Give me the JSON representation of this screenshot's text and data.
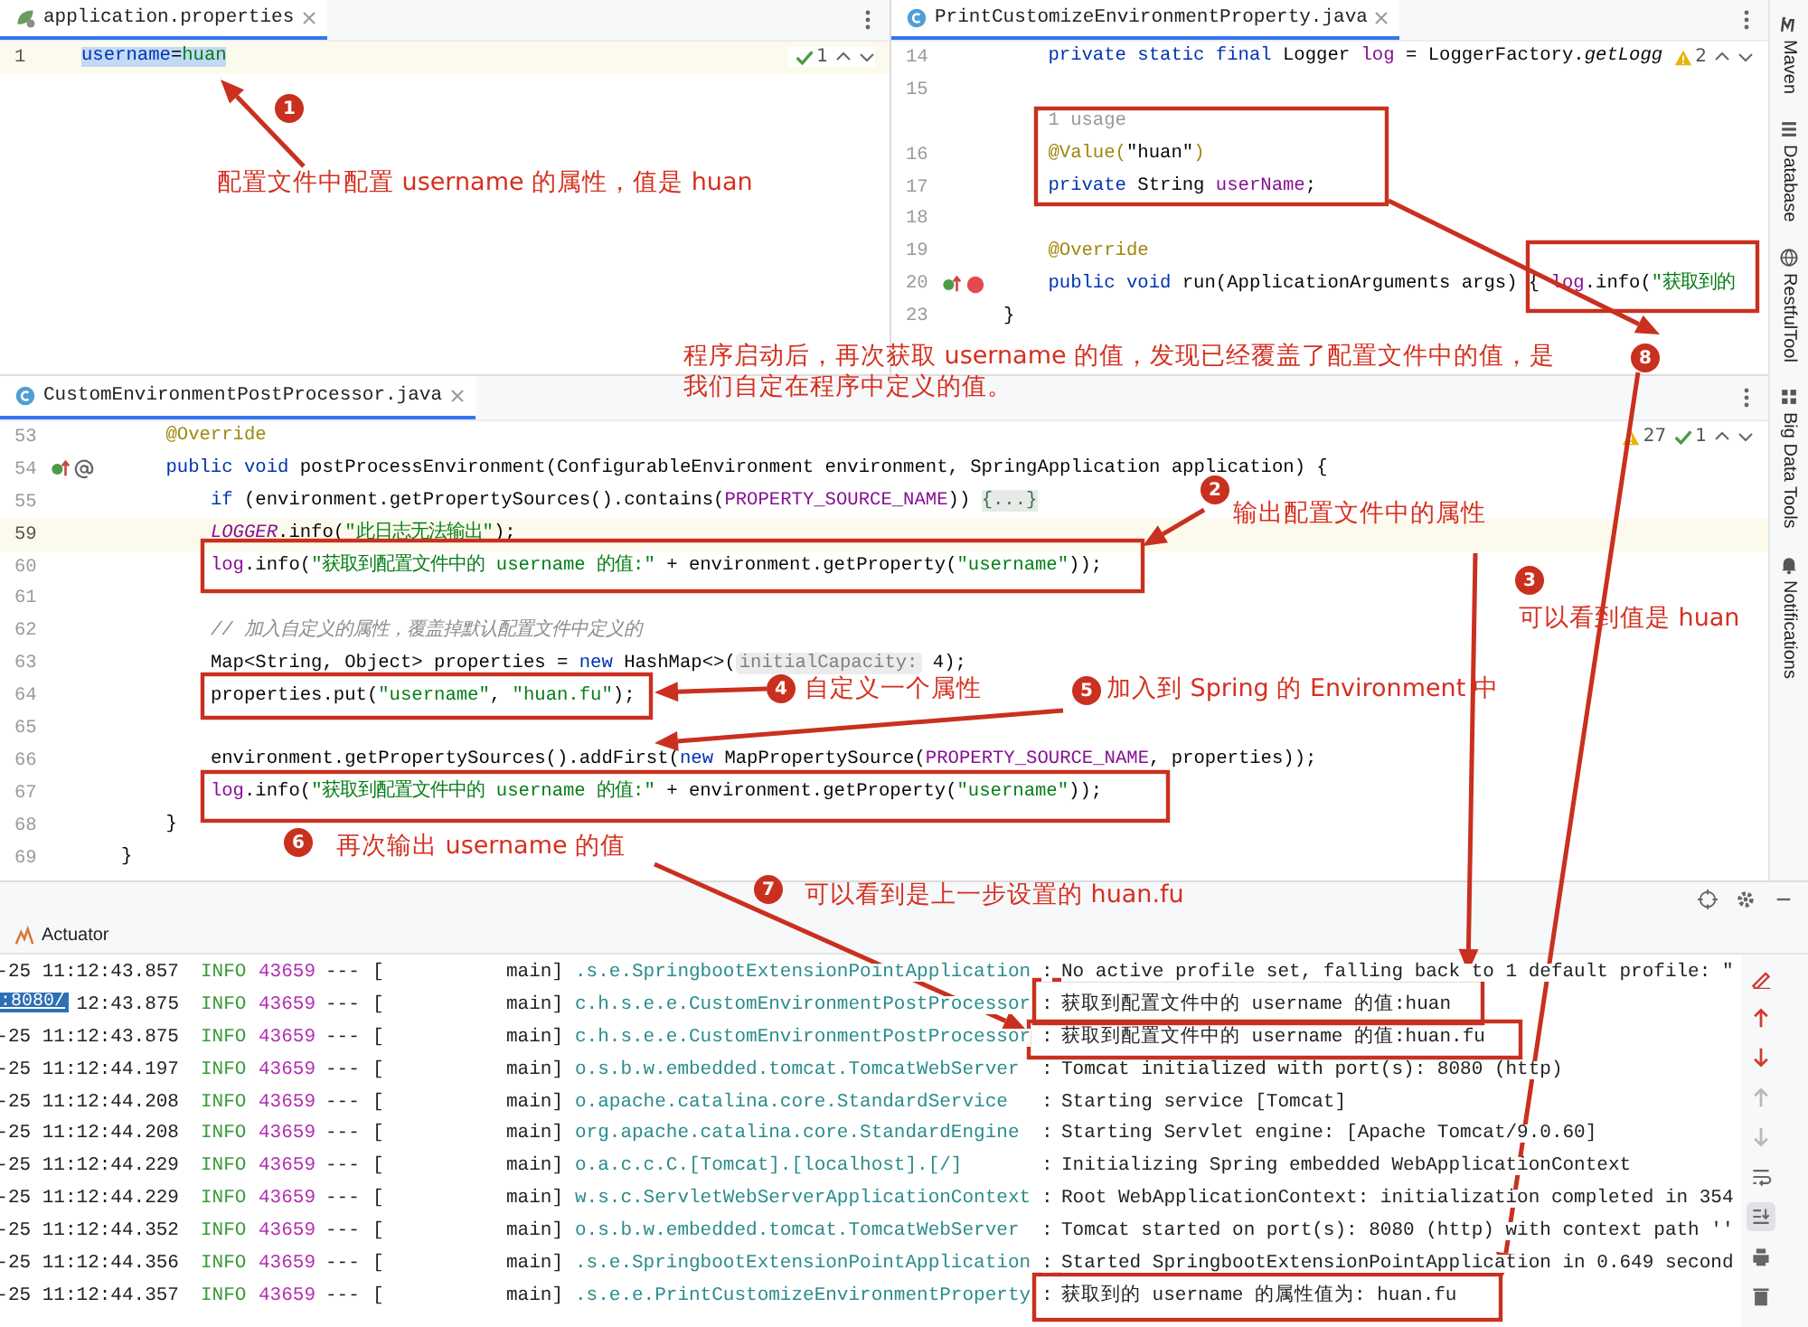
{
  "editors_top": [
    {
      "tab": {
        "name": "application.properties",
        "kind": "properties",
        "selected": true
      },
      "inspections": [
        {
          "kind": "check",
          "count": "1"
        }
      ],
      "lines": [
        {
          "number": "1",
          "current": true,
          "selected": true,
          "tokens": [
            {
              "text": "username",
              "kind": "key"
            },
            {
              "text": "=",
              "kind": "plain"
            },
            {
              "text": "huan",
              "kind": "value"
            }
          ]
        }
      ]
    },
    {
      "tab": {
        "name": "PrintCustomizeEnvironmentProperty.java",
        "kind": "class",
        "selected": true
      },
      "inspections": [
        {
          "kind": "warning",
          "count": "2"
        }
      ],
      "lines": [
        {
          "number": "14",
          "current": false,
          "tokens": [
            {
              "text": "    private static final ",
              "kind": "kw"
            },
            {
              "text": "Logger ",
              "kind": "plain"
            },
            {
              "text": "log",
              "kind": "field"
            },
            {
              "text": " = LoggerFactory.",
              "kind": "plain"
            },
            {
              "text": "getLogg",
              "kind": "italic"
            }
          ]
        },
        {
          "number": "15",
          "current": false
        },
        {
          "current": false,
          "tokens": [
            {
              "text": "    1 usage",
              "kind": "usage"
            }
          ]
        },
        {
          "number": "16",
          "current": false,
          "tokens": [
            {
              "text": "    @Value(",
              "kind": "ann"
            },
            {
              "text": "\"huan\"",
              "kind": "plain"
            },
            {
              "text": ")",
              "kind": "ann"
            }
          ]
        },
        {
          "number": "17",
          "current": false,
          "tokens": [
            {
              "text": "    private ",
              "kind": "kw"
            },
            {
              "text": "String ",
              "kind": "plain"
            },
            {
              "text": "userName",
              "kind": "field"
            },
            {
              "text": ";",
              "kind": "plain"
            }
          ]
        },
        {
          "number": "18",
          "current": false
        },
        {
          "number": "19",
          "current": false,
          "tokens": [
            {
              "text": "    @Override",
              "kind": "ann"
            }
          ]
        },
        {
          "number": "20",
          "current": false,
          "markers": [
            {
              "kind": "override"
            },
            {
              "kind": "breakpoint"
            }
          ],
          "tokens": [
            {
              "text": "    public void ",
              "kind": "kw"
            },
            {
              "text": "run(ApplicationArguments args) { ",
              "kind": "plain"
            },
            {
              "text": "log",
              "kind": "field"
            },
            {
              "text": ".info(",
              "kind": "plain"
            },
            {
              "text": "\"获取到的",
              "kind": "str"
            }
          ]
        },
        {
          "number": "23",
          "current": false,
          "tokens": [
            {
              "text": "}",
              "kind": "plain"
            }
          ]
        }
      ]
    }
  ],
  "main_editor": {
    "tab": {
      "name": "CustomEnvironmentPostProcessor.java",
      "kind": "class",
      "selected": true
    },
    "inspections": [
      {
        "kind": "warning",
        "count": "27"
      },
      {
        "kind": "check",
        "count": "1"
      }
    ],
    "lines": [
      {
        "number": "53",
        "current": false,
        "tokens": [
          {
            "text": "    @Override",
            "kind": "ann"
          }
        ]
      },
      {
        "number": "54",
        "current": false,
        "markers": [
          {
            "kind": "override"
          },
          {
            "kind": "at"
          }
        ],
        "tokens": [
          {
            "text": "    public void ",
            "kind": "kw"
          },
          {
            "text": "postProcessEnvironment(ConfigurableEnvironment environment, SpringApplication application) {",
            "kind": "plain"
          }
        ]
      },
      {
        "number": "55",
        "current": false,
        "tokens": [
          {
            "text": "        if ",
            "kind": "kw"
          },
          {
            "text": "(environment.getPropertySources().contains(",
            "kind": "plain"
          },
          {
            "text": "PROPERTY_SOURCE_NAME",
            "kind": "field"
          },
          {
            "text": ")) ",
            "kind": "plain"
          },
          {
            "text": "{...}",
            "kind": "fold"
          }
        ]
      },
      {
        "number": "59",
        "current": true,
        "tokens": [
          {
            "text": "        LOGGER",
            "kind": "static"
          },
          {
            "text": ".info(",
            "kind": "plain"
          },
          {
            "text": "\"此日志无法输出\"",
            "kind": "str"
          },
          {
            "text": ");",
            "kind": "plain"
          }
        ]
      },
      {
        "number": "60",
        "current": false,
        "tokens": [
          {
            "text": "        log",
            "kind": "field"
          },
          {
            "text": ".info(",
            "kind": "plain"
          },
          {
            "text": "\"获取到配置文件中的 username 的值:\"",
            "kind": "str"
          },
          {
            "text": " + environment.getProperty(",
            "kind": "plain"
          },
          {
            "text": "\"username\"",
            "kind": "str"
          },
          {
            "text": "));",
            "kind": "plain"
          }
        ]
      },
      {
        "number": "61",
        "current": false
      },
      {
        "number": "62",
        "current": false,
        "tokens": [
          {
            "text": "        // 加入自定义的属性，覆盖掉默认配置文件中定义的",
            "kind": "comment"
          }
        ]
      },
      {
        "number": "63",
        "current": false,
        "tokens": [
          {
            "text": "        Map<String, Object> properties = ",
            "kind": "plain"
          },
          {
            "text": "new ",
            "kind": "kw"
          },
          {
            "text": "HashMap<>(",
            "kind": "plain"
          },
          {
            "text": "initialCapacity:",
            "kind": "hint"
          },
          {
            "text": " 4);",
            "kind": "plain"
          }
        ]
      },
      {
        "number": "64",
        "current": false,
        "tokens": [
          {
            "text": "        properties.put(",
            "kind": "plain"
          },
          {
            "text": "\"username\"",
            "kind": "str"
          },
          {
            "text": ", ",
            "kind": "plain"
          },
          {
            "text": "\"huan.fu\"",
            "kind": "str"
          },
          {
            "text": ");",
            "kind": "plain"
          }
        ]
      },
      {
        "number": "65",
        "current": false
      },
      {
        "number": "66",
        "current": false,
        "tokens": [
          {
            "text": "        environment.getPropertySources().addFirst(",
            "kind": "plain"
          },
          {
            "text": "new ",
            "kind": "kw"
          },
          {
            "text": "MapPropertySource(",
            "kind": "plain"
          },
          {
            "text": "PROPERTY_SOURCE_NAME",
            "kind": "field"
          },
          {
            "text": ", properties));",
            "kind": "plain"
          }
        ]
      },
      {
        "number": "67",
        "current": false,
        "tokens": [
          {
            "text": "        log",
            "kind": "field"
          },
          {
            "text": ".info(",
            "kind": "plain"
          },
          {
            "text": "\"获取到配置文件中的 username 的值:\"",
            "kind": "str"
          },
          {
            "text": " + environment.getProperty(",
            "kind": "plain"
          },
          {
            "text": "\"username\"",
            "kind": "str"
          },
          {
            "text": "));",
            "kind": "plain"
          }
        ]
      },
      {
        "number": "68",
        "current": false,
        "tokens": [
          {
            "text": "    }",
            "kind": "plain"
          }
        ]
      },
      {
        "number": "69",
        "current": false,
        "tokens": [
          {
            "text": "}",
            "kind": "plain"
          }
        ]
      }
    ]
  },
  "tool_windows": [
    {
      "kind": "maven",
      "label": "Maven"
    },
    {
      "kind": "database",
      "label": "Database"
    },
    {
      "kind": "globe",
      "label": "RestfulTool"
    },
    {
      "kind": "bigdata",
      "label": "Big Data Tools"
    },
    {
      "kind": "bell",
      "label": "Notifications"
    }
  ],
  "run_panel": {
    "tabs": [
      {
        "label": "Actuator"
      }
    ],
    "link_popup": ":8080/",
    "rows": [
      {
        "time": "-25 11:12:43.857",
        "level": "INFO",
        "pid": "43659",
        "separator": "---",
        "thread_open": "[",
        "thread": "main]",
        "logger": ".s.e.SpringbootExtensionPointApplication",
        "colon": ":",
        "message": "No active profile set, falling back to 1 default profile: \""
      },
      {
        "time": "12:43.875",
        "level": "INFO",
        "pid": "43659",
        "separator": "---",
        "thread_open": "[",
        "thread": "main]",
        "logger": "c.h.s.e.e.CustomEnvironmentPostProcessor",
        "colon": ":",
        "message": "获取到配置文件中的 username 的值:huan"
      },
      {
        "time": "-25 11:12:43.875",
        "level": "INFO",
        "pid": "43659",
        "separator": "---",
        "thread_open": "[",
        "thread": "main]",
        "logger": "c.h.s.e.e.CustomEnvironmentPostProcessor",
        "colon": ":",
        "message": "获取到配置文件中的 username 的值:huan.fu"
      },
      {
        "time": "-25 11:12:44.197",
        "level": "INFO",
        "pid": "43659",
        "separator": "---",
        "thread_open": "[",
        "thread": "main]",
        "logger": "o.s.b.w.embedded.tomcat.TomcatWebServer",
        "colon": ":",
        "message": "Tomcat initialized with port(s): 8080 (http)"
      },
      {
        "time": "-25 11:12:44.208",
        "level": "INFO",
        "pid": "43659",
        "separator": "---",
        "thread_open": "[",
        "thread": "main]",
        "logger": "o.apache.catalina.core.StandardService",
        "colon": ":",
        "message": "Starting service [Tomcat]"
      },
      {
        "time": "-25 11:12:44.208",
        "level": "INFO",
        "pid": "43659",
        "separator": "---",
        "thread_open": "[",
        "thread": "main]",
        "logger": "org.apache.catalina.core.StandardEngine",
        "colon": ":",
        "message": "Starting Servlet engine: [Apache Tomcat/9.0.60]"
      },
      {
        "time": "-25 11:12:44.229",
        "level": "INFO",
        "pid": "43659",
        "separator": "---",
        "thread_open": "[",
        "thread": "main]",
        "logger": "o.a.c.c.C.[Tomcat].[localhost].[/]",
        "colon": ":",
        "message": "Initializing Spring embedded WebApplicationContext"
      },
      {
        "time": "-25 11:12:44.229",
        "level": "INFO",
        "pid": "43659",
        "separator": "---",
        "thread_open": "[",
        "thread": "main]",
        "logger": "w.s.c.ServletWebServerApplicationContext",
        "colon": ":",
        "message": "Root WebApplicationContext: initialization completed in 354"
      },
      {
        "time": "-25 11:12:44.352",
        "level": "INFO",
        "pid": "43659",
        "separator": "---",
        "thread_open": "[",
        "thread": "main]",
        "logger": "o.s.b.w.embedded.tomcat.TomcatWebServer",
        "colon": ":",
        "message": "Tomcat started on port(s): 8080 (http) with context path ''"
      },
      {
        "time": "-25 11:12:44.356",
        "level": "INFO",
        "pid": "43659",
        "separator": "---",
        "thread_open": "[",
        "thread": "main]",
        "logger": ".s.e.SpringbootExtensionPointApplication",
        "colon": ":",
        "message": "Started SpringbootExtensionPointApplication in 0.649 second"
      },
      {
        "time": "-25 11:12:44.357",
        "level": "INFO",
        "pid": "43659",
        "separator": "---",
        "thread_open": "[",
        "thread": "main]",
        "logger": ".s.e.e.PrintCustomizeEnvironmentProperty",
        "colon": ":",
        "message": "获取到的 username 的属性值为: huan.fu"
      }
    ],
    "console_tools": [
      {
        "kind": "edit",
        "disabled": false,
        "selected": false
      },
      {
        "kind": "up",
        "disabled": false,
        "selected": false
      },
      {
        "kind": "down",
        "disabled": false,
        "selected": false
      },
      {
        "kind": "up",
        "disabled": true,
        "selected": false
      },
      {
        "kind": "down",
        "disabled": true,
        "selected": false
      },
      {
        "kind": "wrap",
        "disabled": false,
        "selected": false
      },
      {
        "kind": "scroll-end",
        "disabled": false,
        "selected": true
      },
      {
        "kind": "print",
        "disabled": false,
        "selected": false
      },
      {
        "kind": "delete",
        "disabled": false,
        "selected": false
      }
    ]
  },
  "annotations": [
    {
      "number": "1",
      "note": "配置文件中配置 username 的属性，值是 huan"
    },
    {
      "number": "2",
      "note": "输出配置文件中的属性"
    },
    {
      "number": "3",
      "note": "可以看到值是 huan"
    },
    {
      "number": "4",
      "note": "自定义一个属性"
    },
    {
      "number": "5",
      "note": "加入到 Spring 的 Environment 中"
    },
    {
      "number": "6",
      "note": "再次输出 username 的值"
    },
    {
      "number": "7",
      "note": "可以看到是上一步设置的 huan.fu"
    },
    {
      "number": "8",
      "note": "程序启动后，再次获取 username 的值，发现已经覆盖了配置文件中的值，是我们自定在程序中定义的值。"
    }
  ]
}
